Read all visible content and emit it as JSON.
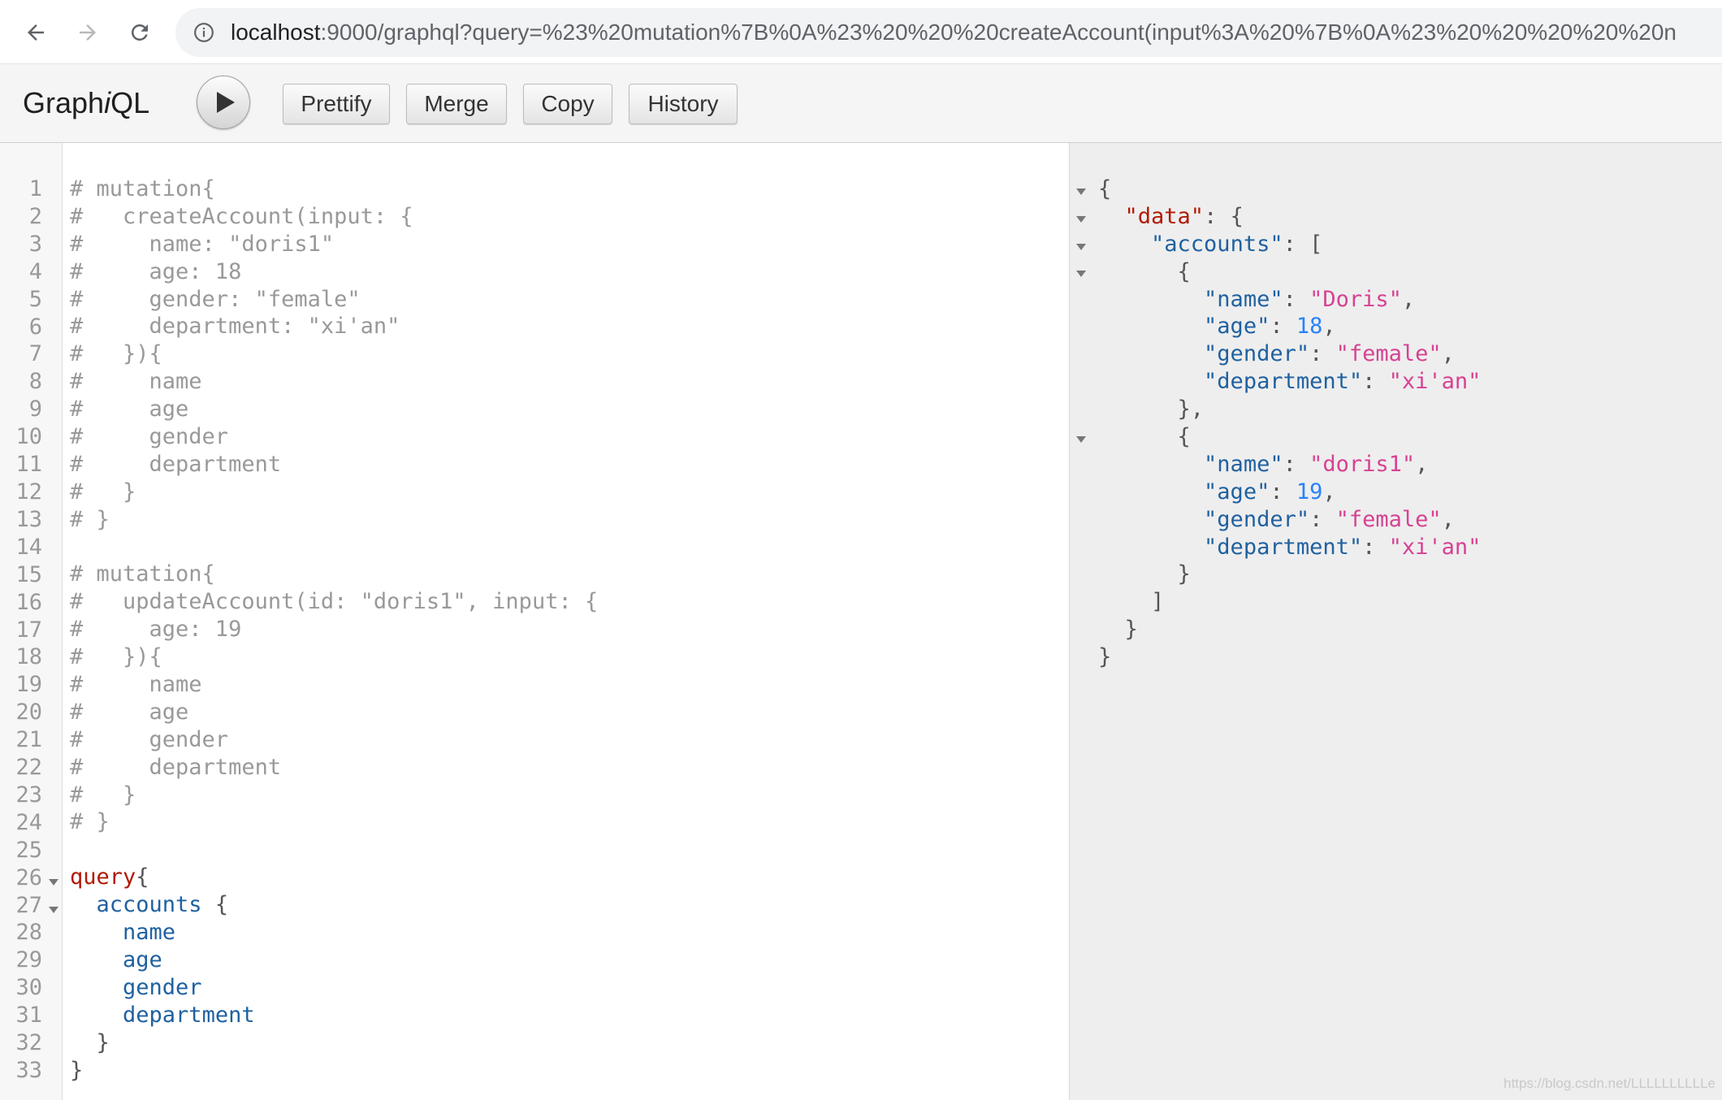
{
  "browser": {
    "url_host": "localhost",
    "url_rest": ":9000/graphql?query=%23%20mutation%7B%0A%23%20%20%20createAccount(input%3A%20%7B%0A%23%20%20%20%20%20n"
  },
  "toolbar": {
    "logo_pre": "Graph",
    "logo_i": "i",
    "logo_post": "QL",
    "buttons": [
      "Prettify",
      "Merge",
      "Copy",
      "History"
    ]
  },
  "editor": {
    "line_count": 33,
    "lines": [
      "# mutation{",
      "#   createAccount(input: {",
      "#     name: \"doris1\"",
      "#     age: 18",
      "#     gender: \"female\"",
      "#     department: \"xi'an\"",
      "#   }){",
      "#     name",
      "#     age",
      "#     gender",
      "#     department",
      "#   }",
      "# }",
      "",
      "# mutation{",
      "#   updateAccount(id: \"doris1\", input: {",
      "#     age: 19",
      "#   }){",
      "#     name",
      "#     age",
      "#     gender",
      "#     department",
      "#   }",
      "# }",
      "",
      "query{",
      "  accounts {",
      "    name",
      "    age",
      "    gender",
      "    department",
      "  }",
      "}"
    ]
  },
  "result": {
    "root_key": "data",
    "list_key": "accounts",
    "accounts": [
      {
        "name": "Doris",
        "age": 18,
        "gender": "female",
        "department": "xi'an"
      },
      {
        "name": "doris1",
        "age": 19,
        "gender": "female",
        "department": "xi'an"
      }
    ]
  },
  "watermark": "https://blog.csdn.net/LLLLLLLLLLe"
}
